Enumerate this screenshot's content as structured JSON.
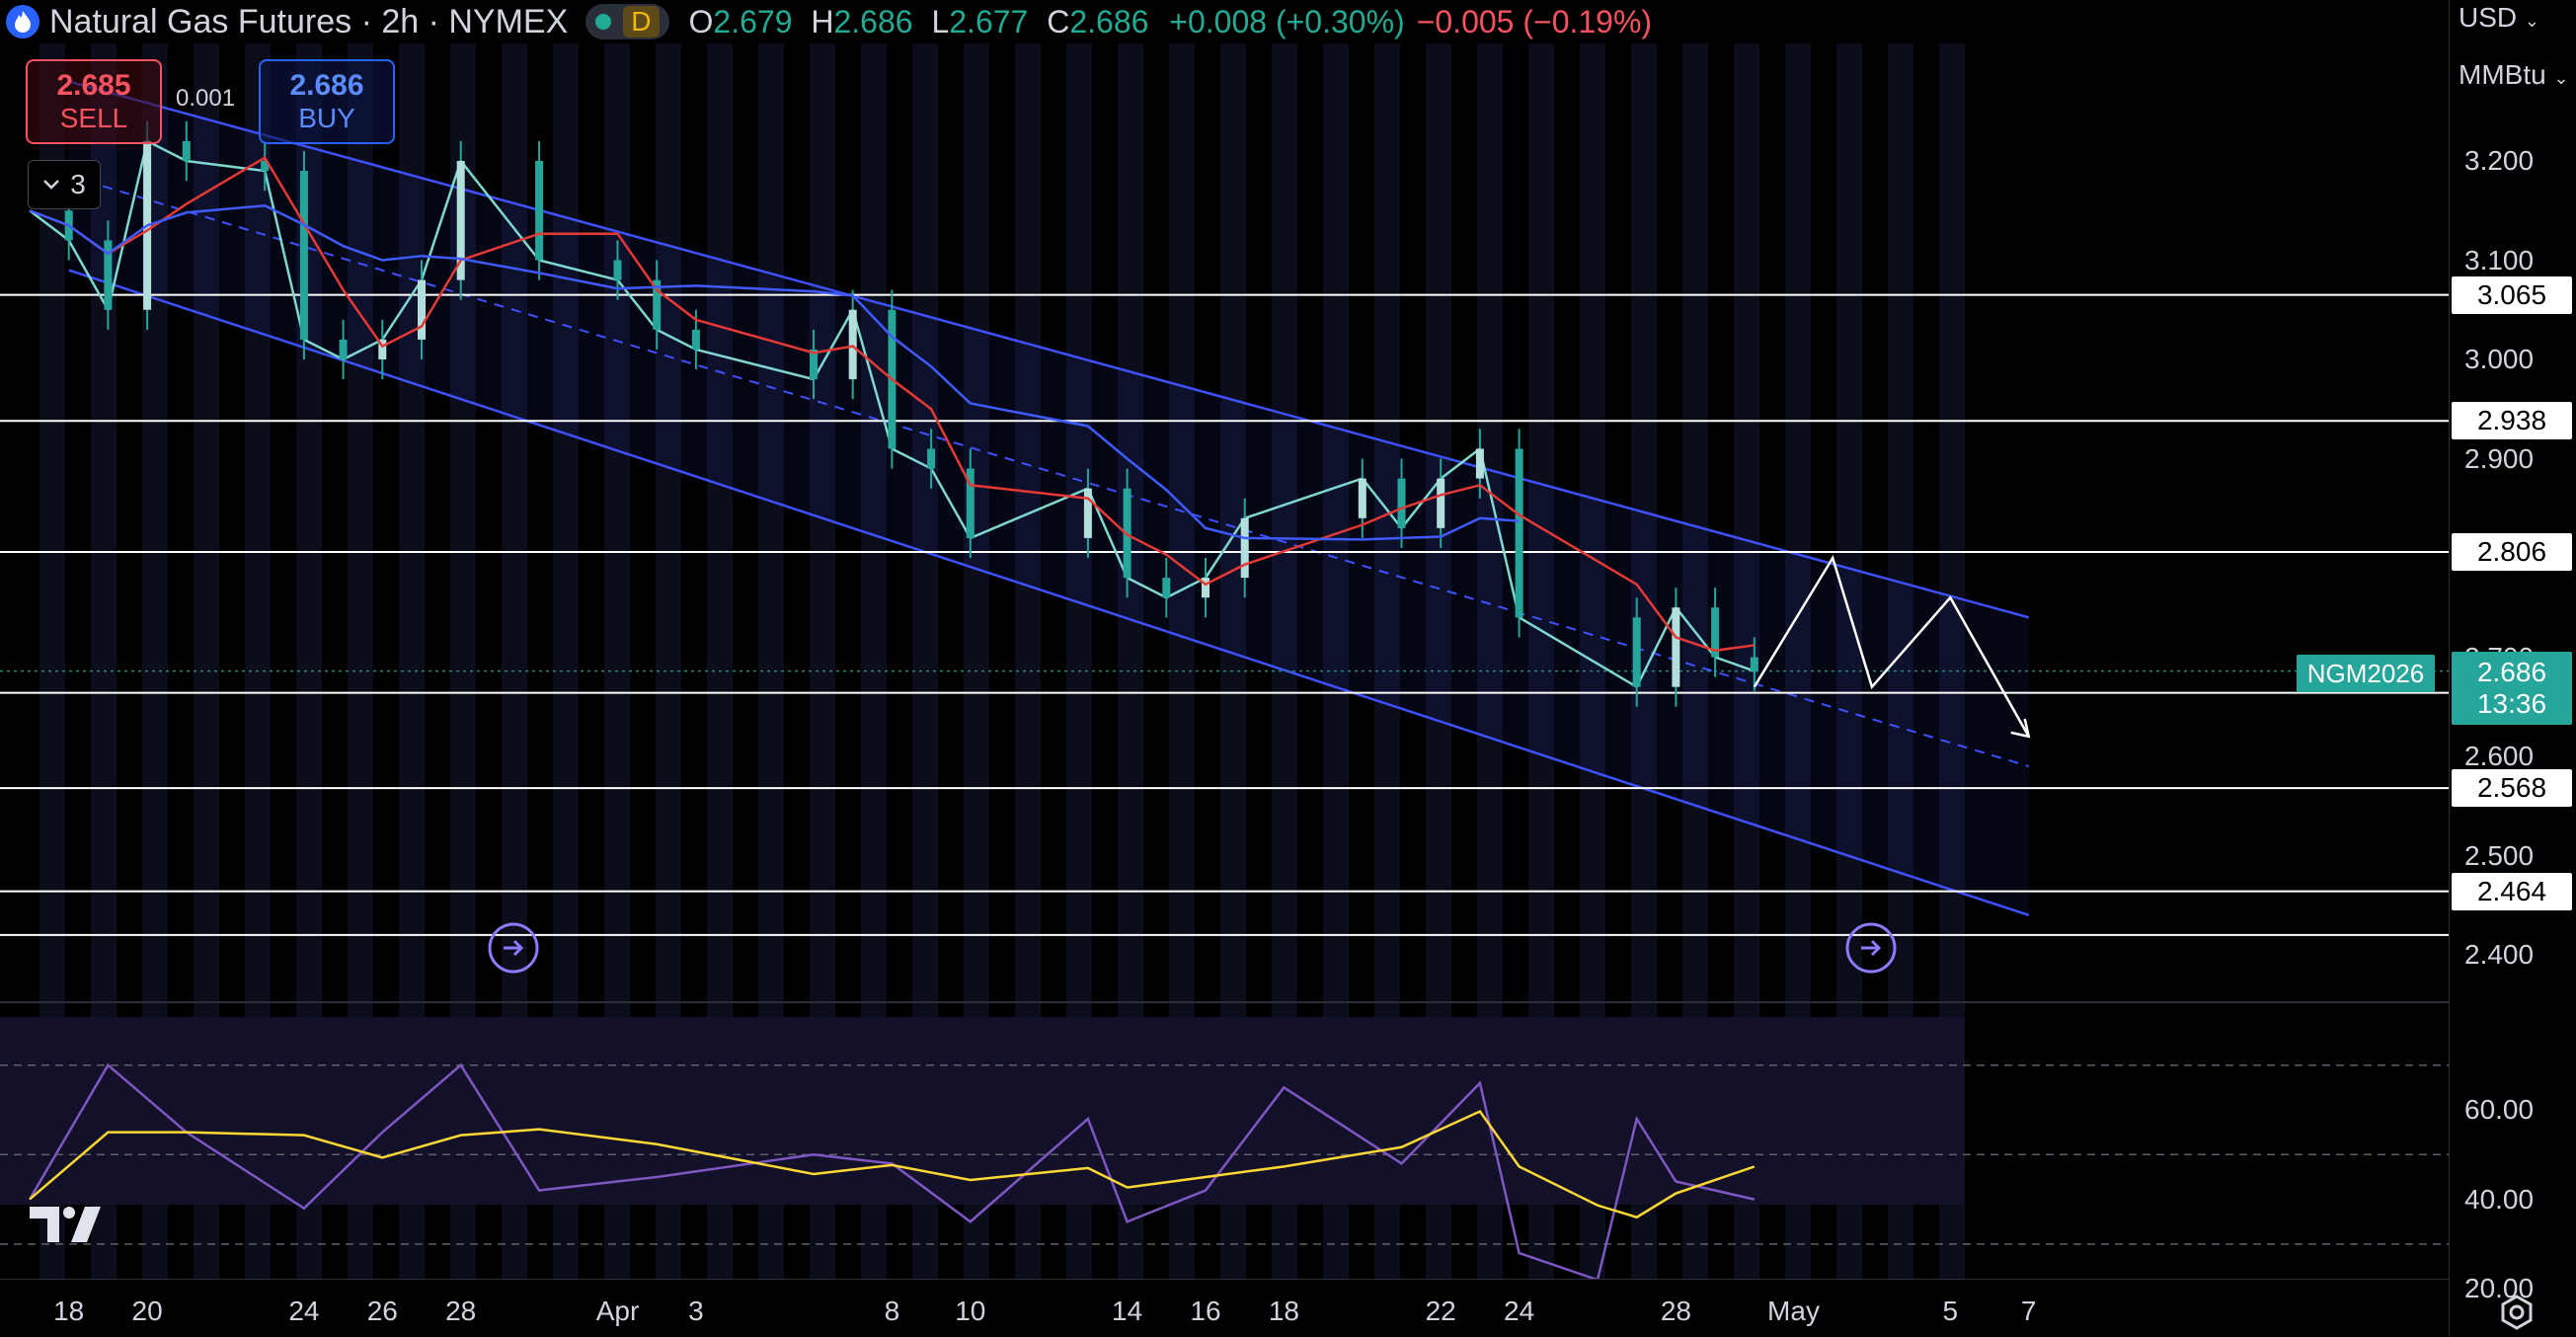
{
  "header": {
    "title": "Natural Gas Futures · 2h · NYMEX",
    "market_flag": "D",
    "open_label": "O",
    "open": "2.679",
    "high_label": "H",
    "high": "2.686",
    "low_label": "L",
    "low": "2.677",
    "close_label": "C",
    "close": "2.686",
    "change": "+0.008 (+0.30%)",
    "change2": "−0.005 (−0.19%)"
  },
  "trade": {
    "sell_price": "2.685",
    "sell_label": "SELL",
    "buy_price": "2.686",
    "buy_label": "BUY",
    "spread": "0.001"
  },
  "indicators_toggle": {
    "count": "3"
  },
  "price_axis": {
    "currency": "USD",
    "unit": "MMBtu",
    "ticks": [
      "3.200",
      "3.100",
      "3.000",
      "2.900",
      "2.700",
      "2.600",
      "2.500",
      "2.400"
    ],
    "level_labels": [
      "3.065",
      "2.938",
      "2.806",
      "2.664",
      "2.568",
      "2.464"
    ],
    "current_price": "2.686",
    "countdown": "13:36",
    "symbol": "NGM2026"
  },
  "rsi_axis": {
    "ticks": [
      "60.00",
      "40.00",
      "20.00"
    ]
  },
  "time_axis": {
    "labels": [
      "18",
      "20",
      "24",
      "26",
      "28",
      "Apr",
      "3",
      "8",
      "10",
      "14",
      "16",
      "18",
      "22",
      "24",
      "28",
      "May",
      "5",
      "7"
    ]
  },
  "colors": {
    "background": "#000000",
    "up_candle": "#26a69a",
    "channel": "#3f51ff",
    "ma_fast": "#e53935",
    "ma_slow": "#3f5bff",
    "rsi": "#7e57c2",
    "rsi_ma": "#fdd835",
    "levels": "#ffffff"
  },
  "chart_data": {
    "type": "line",
    "title": "Natural Gas Futures · 2h · NYMEX",
    "price_ylim": [
      2.355,
      3.255
    ],
    "horizontal_levels": [
      3.065,
      2.938,
      2.806,
      2.664,
      2.568,
      2.464,
      2.42
    ],
    "close_series": [
      {
        "date": "03-17",
        "close": 3.15
      },
      {
        "date": "03-18",
        "close": 3.12
      },
      {
        "date": "03-19",
        "close": 3.05
      },
      {
        "date": "03-20",
        "close": 3.22
      },
      {
        "date": "03-21",
        "close": 3.2
      },
      {
        "date": "03-23",
        "close": 3.19
      },
      {
        "date": "03-24",
        "close": 3.02
      },
      {
        "date": "03-25",
        "close": 3.0
      },
      {
        "date": "03-26",
        "close": 3.02
      },
      {
        "date": "03-27",
        "close": 3.08
      },
      {
        "date": "03-28",
        "close": 3.2
      },
      {
        "date": "03-30",
        "close": 3.1
      },
      {
        "date": "04-01",
        "close": 3.08
      },
      {
        "date": "04-02",
        "close": 3.03
      },
      {
        "date": "04-03",
        "close": 3.01
      },
      {
        "date": "04-06",
        "close": 2.98
      },
      {
        "date": "04-07",
        "close": 3.05
      },
      {
        "date": "04-08",
        "close": 2.91
      },
      {
        "date": "04-09",
        "close": 2.89
      },
      {
        "date": "04-10",
        "close": 2.82
      },
      {
        "date": "04-13",
        "close": 2.87
      },
      {
        "date": "04-14",
        "close": 2.78
      },
      {
        "date": "04-15",
        "close": 2.76
      },
      {
        "date": "04-16",
        "close": 2.78
      },
      {
        "date": "04-17",
        "close": 2.84
      },
      {
        "date": "04-20",
        "close": 2.88
      },
      {
        "date": "04-21",
        "close": 2.83
      },
      {
        "date": "04-22",
        "close": 2.88
      },
      {
        "date": "04-23",
        "close": 2.91
      },
      {
        "date": "04-24",
        "close": 2.74
      },
      {
        "date": "04-27",
        "close": 2.67
      },
      {
        "date": "04-28",
        "close": 2.75
      },
      {
        "date": "04-29",
        "close": 2.7
      },
      {
        "date": "04-30",
        "close": 2.686
      }
    ],
    "projection": [
      {
        "date": "04-30",
        "value": 2.67
      },
      {
        "date": "05-02",
        "value": 2.8
      },
      {
        "date": "05-03",
        "value": 2.67
      },
      {
        "date": "05-05",
        "value": 2.76
      },
      {
        "date": "05-07",
        "value": 2.62
      }
    ],
    "channel": {
      "upper": [
        {
          "date": "03-18",
          "value": 3.28
        },
        {
          "date": "05-07",
          "value": 2.74
        }
      ],
      "lower": [
        {
          "date": "03-18",
          "value": 3.09
        },
        {
          "date": "05-07",
          "value": 2.44
        }
      ]
    },
    "rsi_ylim": [
      14,
      82
    ],
    "rsi_bands": [
      70,
      50,
      30
    ],
    "rsi_series": [
      {
        "date": "03-17",
        "rsi": 40
      },
      {
        "date": "03-19",
        "rsi": 70
      },
      {
        "date": "03-21",
        "rsi": 55
      },
      {
        "date": "03-24",
        "rsi": 38
      },
      {
        "date": "03-26",
        "rsi": 55
      },
      {
        "date": "03-28",
        "rsi": 70
      },
      {
        "date": "03-30",
        "rsi": 42
      },
      {
        "date": "04-02",
        "rsi": 45
      },
      {
        "date": "04-06",
        "rsi": 50
      },
      {
        "date": "04-08",
        "rsi": 48
      },
      {
        "date": "04-10",
        "rsi": 35
      },
      {
        "date": "04-13",
        "rsi": 58
      },
      {
        "date": "04-14",
        "rsi": 35
      },
      {
        "date": "04-16",
        "rsi": 42
      },
      {
        "date": "04-18",
        "rsi": 65
      },
      {
        "date": "04-21",
        "rsi": 48
      },
      {
        "date": "04-23",
        "rsi": 66
      },
      {
        "date": "04-24",
        "rsi": 28
      },
      {
        "date": "04-26",
        "rsi": 22
      },
      {
        "date": "04-27",
        "rsi": 58
      },
      {
        "date": "04-28",
        "rsi": 44
      },
      {
        "date": "04-30",
        "rsi": 40
      }
    ]
  }
}
